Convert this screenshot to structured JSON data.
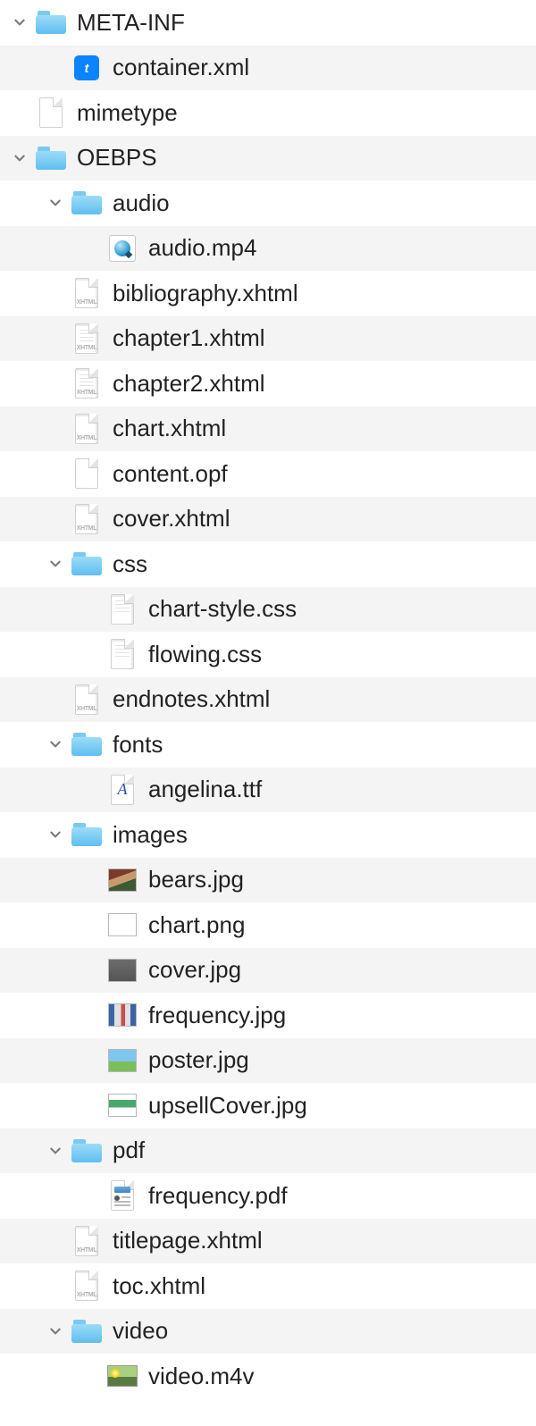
{
  "indentUnit": 40,
  "tree": [
    {
      "depth": 0,
      "type": "folder",
      "name": "META-INF",
      "expanded": true,
      "icon": "folder"
    },
    {
      "depth": 1,
      "type": "file",
      "name": "container.xml",
      "icon": "xml"
    },
    {
      "depth": 0,
      "type": "file",
      "name": "mimetype",
      "icon": "blank"
    },
    {
      "depth": 0,
      "type": "folder",
      "name": "OEBPS",
      "expanded": true,
      "icon": "folder"
    },
    {
      "depth": 1,
      "type": "folder",
      "name": "audio",
      "expanded": true,
      "icon": "folder"
    },
    {
      "depth": 2,
      "type": "file",
      "name": "audio.mp4",
      "icon": "quicktime"
    },
    {
      "depth": 1,
      "type": "file",
      "name": "bibliography.xhtml",
      "icon": "xhtml"
    },
    {
      "depth": 1,
      "type": "file",
      "name": "chapter1.xhtml",
      "icon": "xhtml-lines"
    },
    {
      "depth": 1,
      "type": "file",
      "name": "chapter2.xhtml",
      "icon": "xhtml-lines"
    },
    {
      "depth": 1,
      "type": "file",
      "name": "chart.xhtml",
      "icon": "xhtml"
    },
    {
      "depth": 1,
      "type": "file",
      "name": "content.opf",
      "icon": "blank"
    },
    {
      "depth": 1,
      "type": "file",
      "name": "cover.xhtml",
      "icon": "xhtml"
    },
    {
      "depth": 1,
      "type": "folder",
      "name": "css",
      "expanded": true,
      "icon": "folder"
    },
    {
      "depth": 2,
      "type": "file",
      "name": "chart-style.css",
      "icon": "css"
    },
    {
      "depth": 2,
      "type": "file",
      "name": "flowing.css",
      "icon": "css"
    },
    {
      "depth": 1,
      "type": "file",
      "name": "endnotes.xhtml",
      "icon": "xhtml"
    },
    {
      "depth": 1,
      "type": "folder",
      "name": "fonts",
      "expanded": true,
      "icon": "folder"
    },
    {
      "depth": 2,
      "type": "file",
      "name": "angelina.ttf",
      "icon": "font"
    },
    {
      "depth": 1,
      "type": "folder",
      "name": "images",
      "expanded": true,
      "icon": "folder"
    },
    {
      "depth": 2,
      "type": "file",
      "name": "bears.jpg",
      "icon": "thumb",
      "thumb": "bears"
    },
    {
      "depth": 2,
      "type": "file",
      "name": "chart.png",
      "icon": "thumb",
      "thumb": "chart"
    },
    {
      "depth": 2,
      "type": "file",
      "name": "cover.jpg",
      "icon": "thumb",
      "thumb": "cover"
    },
    {
      "depth": 2,
      "type": "file",
      "name": "frequency.jpg",
      "icon": "thumb",
      "thumb": "frequency"
    },
    {
      "depth": 2,
      "type": "file",
      "name": "poster.jpg",
      "icon": "thumb",
      "thumb": "poster"
    },
    {
      "depth": 2,
      "type": "file",
      "name": "upsellCover.jpg",
      "icon": "thumb",
      "thumb": "upsell"
    },
    {
      "depth": 1,
      "type": "folder",
      "name": "pdf",
      "expanded": true,
      "icon": "folder"
    },
    {
      "depth": 2,
      "type": "file",
      "name": "frequency.pdf",
      "icon": "pdf"
    },
    {
      "depth": 1,
      "type": "file",
      "name": "titlepage.xhtml",
      "icon": "xhtml"
    },
    {
      "depth": 1,
      "type": "file",
      "name": "toc.xhtml",
      "icon": "xhtml"
    },
    {
      "depth": 1,
      "type": "folder",
      "name": "video",
      "expanded": true,
      "icon": "folder"
    },
    {
      "depth": 2,
      "type": "file",
      "name": "video.m4v",
      "icon": "video"
    }
  ],
  "thumbs": {
    "bears": "linear-gradient(160deg,#7a3b2e 0 35%, #c79a6b 35% 60%, #3d5a34 60% 100%)",
    "chart": "linear-gradient(#ffffff,#ffffff)",
    "cover": "linear-gradient(#6d6d6d,#545454)",
    "frequency": "linear-gradient(90deg,#3b63a5 0 20%,#e0e0e0 20% 45%,#c94d4d 45% 60%,#e0e0e0 60% 80%,#3b63a5 80% 100%)",
    "poster": "linear-gradient(#7fc6ef 0 55%, #7bbf5a 55% 100%)",
    "upsell": "linear-gradient(#ffffff 0 25%, #4aa86f 25% 60%, #ffffff 60% 100%)"
  }
}
